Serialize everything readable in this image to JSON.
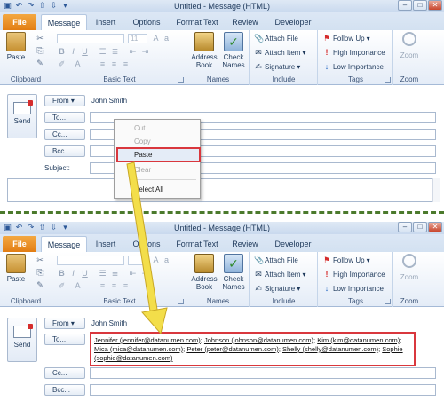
{
  "window_title": "Untitled - Message (HTML)",
  "tabs": [
    "File",
    "Message",
    "Insert",
    "Options",
    "Format Text",
    "Review",
    "Developer"
  ],
  "clipboard": {
    "paste": "Paste",
    "label": "Clipboard"
  },
  "basic_text": {
    "font_size": "11",
    "label": "Basic Text"
  },
  "names": {
    "address_book": "Address Book",
    "check_names": "Check Names",
    "label": "Names"
  },
  "include": {
    "attach_file": "Attach File",
    "attach_item": "Attach Item",
    "signature": "Signature",
    "label": "Include"
  },
  "tags": {
    "follow_up": "Follow Up",
    "high": "High Importance",
    "low": "Low Importance",
    "label": "Tags"
  },
  "zoom": {
    "zoom": "Zoom",
    "label": "Zoom"
  },
  "form": {
    "send": "Send",
    "from": "From",
    "from_value": "John Smith",
    "to": "To...",
    "cc": "Cc...",
    "bcc": "Bcc...",
    "subject": "Subject:"
  },
  "context_menu": {
    "cut": "Cut",
    "copy": "Copy",
    "paste": "Paste",
    "clear": "Clear",
    "select_all": "Select All"
  },
  "recipients": [
    "Jennifer (jennifer@datanumen.com)",
    "Johnson (johnson@datanumen.com)",
    "Kim (kim@datanumen.com)",
    "Mica (mica@datanumen.com)",
    "Peter (peter@datanumen.com)",
    "Shelly (shelly@datanumen.com)",
    "Sophie (sophie@datanumen.com)"
  ],
  "colors": {
    "file_tab": "#e27d13",
    "highlight": "#d9373d",
    "divider": "#4b7a2c",
    "arrow": "#f3de4a"
  }
}
